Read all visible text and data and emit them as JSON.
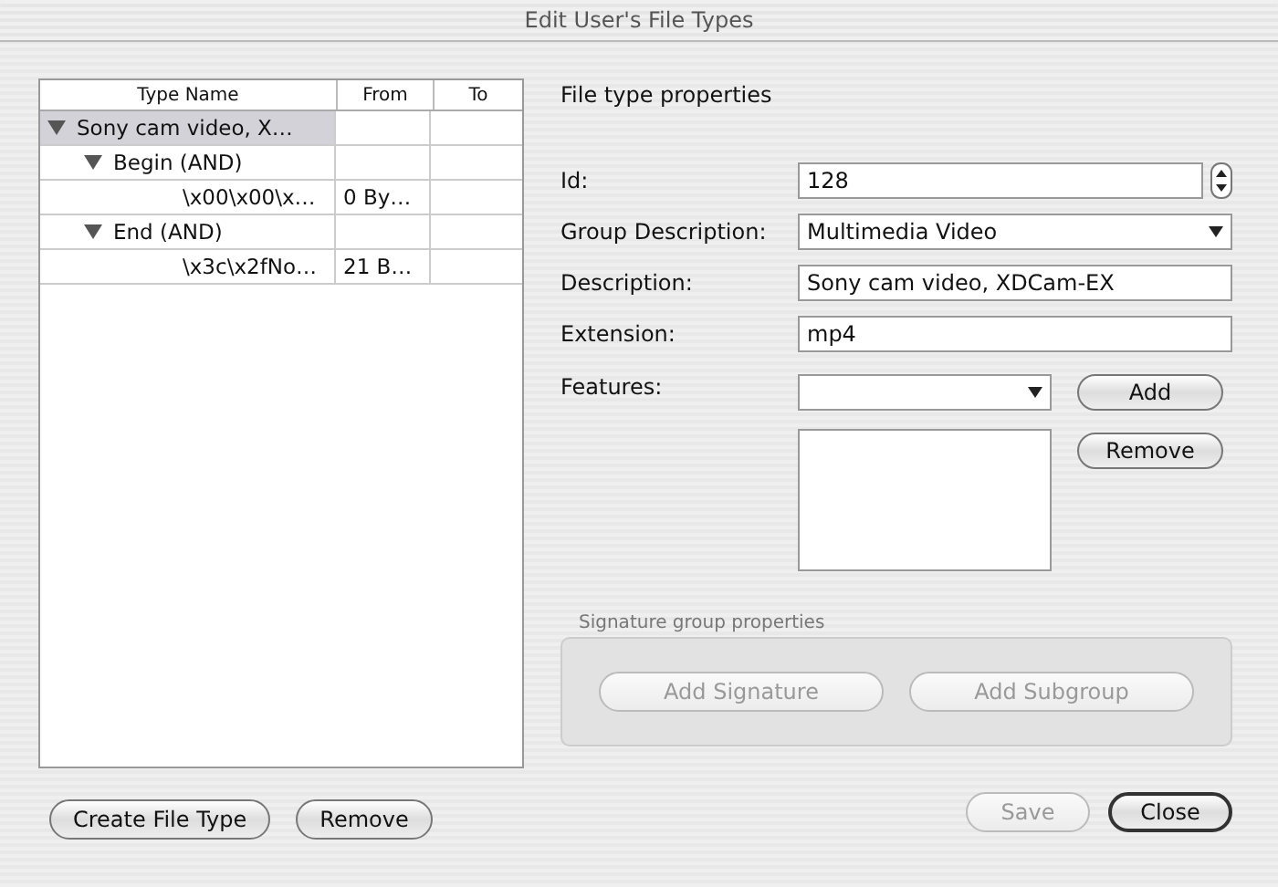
{
  "window": {
    "title": "Edit User's File Types"
  },
  "tree": {
    "columns": [
      "Type Name",
      "From",
      "To"
    ],
    "rows": [
      {
        "name": "Sony cam video, X…",
        "expanded": true,
        "selected": true,
        "children": [
          {
            "name": "Begin (AND)",
            "expanded": true,
            "selected": false,
            "children": [
              {
                "name": "\\x00\\x00\\x…",
                "from": "0 By…",
                "selected": false
              }
            ]
          },
          {
            "name": "End (AND)",
            "expanded": true,
            "selected": false,
            "children": [
              {
                "name": "\\x3c\\x2fNo…",
                "from": "21 B…",
                "selected": false
              }
            ]
          }
        ]
      }
    ]
  },
  "properties": {
    "title": "File type properties",
    "fields": [
      {
        "kind": "spinner",
        "label": "Id:",
        "value": "128"
      },
      {
        "kind": "dropdown",
        "label": "Group Description:",
        "value": "Multimedia Video"
      },
      {
        "kind": "text",
        "label": "Description:",
        "value": "Sony cam video, XDCam-EX"
      },
      {
        "kind": "text",
        "label": "Extension:",
        "value": "mp4"
      }
    ],
    "features": {
      "label": "Features:",
      "add": "Add",
      "remove": "Remove"
    }
  },
  "signature_group": {
    "title": "Signature group properties",
    "buttons": [
      {
        "label": "Add Signature",
        "disabled": true
      },
      {
        "label": "Add Subgroup",
        "disabled": true
      }
    ]
  },
  "left_buttons": [
    {
      "label": "Create File Type",
      "disabled": false
    },
    {
      "label": "Remove",
      "disabled": false
    }
  ],
  "right_buttons": [
    {
      "label": "Save",
      "disabled": true,
      "default": false
    },
    {
      "label": "Close",
      "disabled": false,
      "default": true
    }
  ]
}
